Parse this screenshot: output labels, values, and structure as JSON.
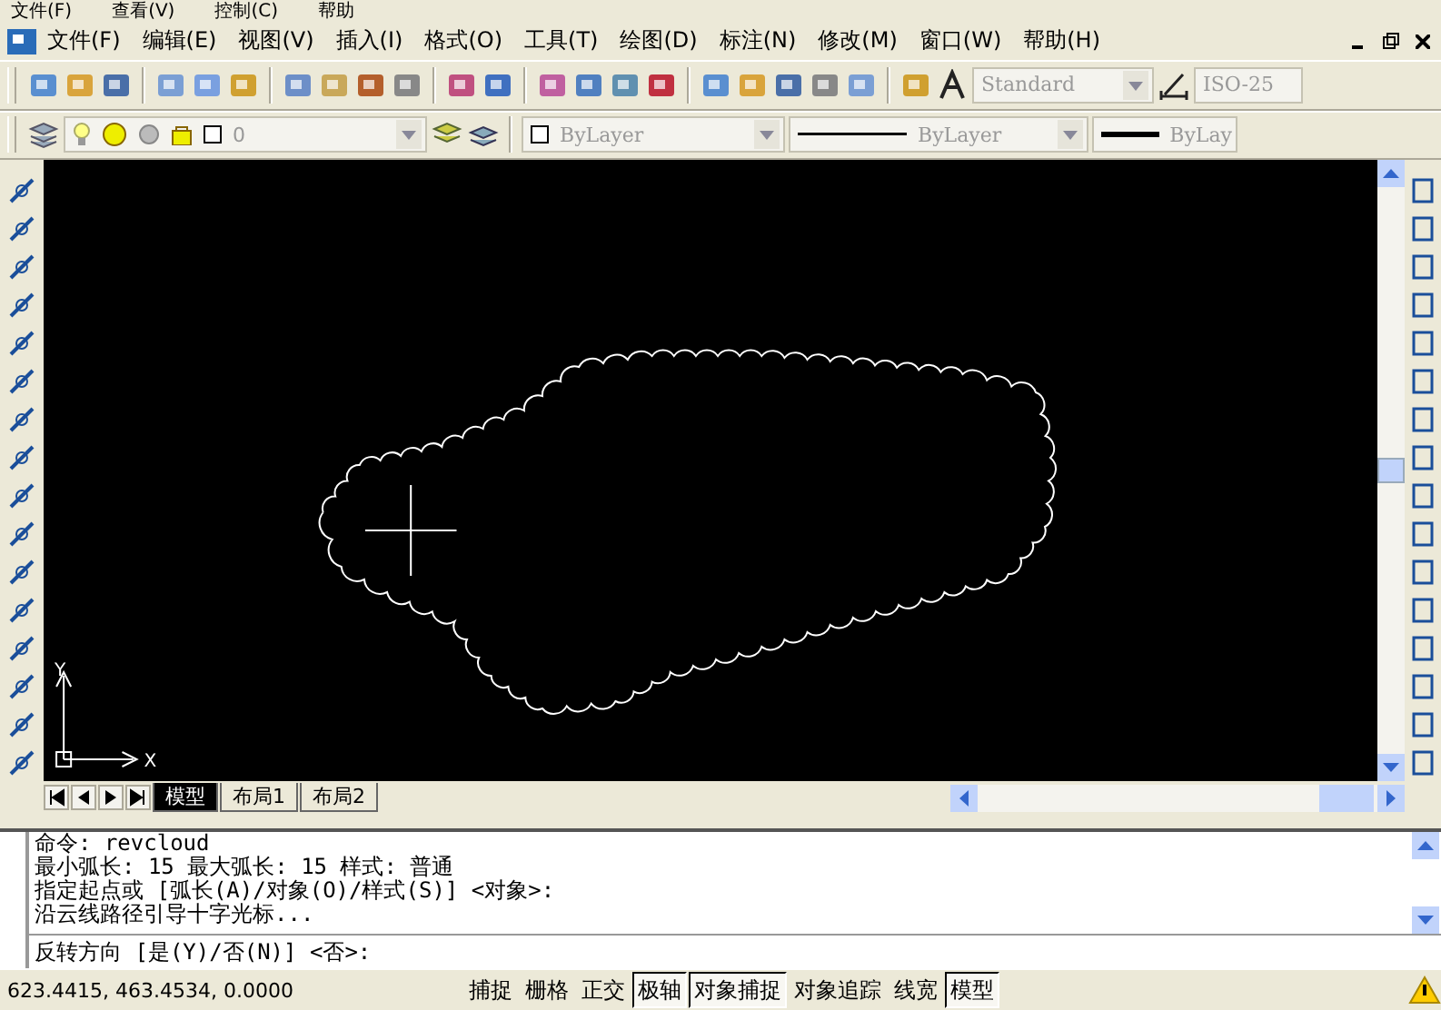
{
  "outer_menu": [
    "文件(F)",
    "查看(V)",
    "控制(C)",
    "帮助"
  ],
  "menu": [
    "文件(F)",
    "编辑(E)",
    "视图(V)",
    "插入(I)",
    "格式(O)",
    "工具(T)",
    "绘图(D)",
    "标注(N)",
    "修改(M)",
    "窗口(W)",
    "帮助(H)"
  ],
  "toolbar": {
    "text_style": "Standard",
    "dim_style": "ISO-25"
  },
  "properties": {
    "layer": "0",
    "color_setting": "ByLayer",
    "linetype": "ByLayer",
    "lineweight": "ByLay"
  },
  "ucs": {
    "x": "X",
    "y": "Y"
  },
  "layout_tabs": [
    {
      "label": "模型",
      "selected": true
    },
    {
      "label": "布局1",
      "selected": false
    },
    {
      "label": "布局2",
      "selected": false
    }
  ],
  "command_history": [
    "命令: revcloud",
    "最小弧长: 15   最大弧长: 15   样式: 普通",
    "指定起点或 [弧长(A)/对象(O)/样式(S)] <对象>:",
    "沿云线路径引导十字光标..."
  ],
  "command_prompt": "反转方向 [是(Y)/否(N)] <否>:",
  "coordinates": "623.4415,  463.4534, 0.0000",
  "status_buttons": [
    {
      "label": "捕捉",
      "on": false
    },
    {
      "label": "栅格",
      "on": false
    },
    {
      "label": "正交",
      "on": false
    },
    {
      "label": "极轴",
      "on": true
    },
    {
      "label": "对象捕捉",
      "on": true
    },
    {
      "label": "对象追踪",
      "on": false
    },
    {
      "label": "线宽",
      "on": false
    },
    {
      "label": "模型",
      "on": true
    }
  ]
}
